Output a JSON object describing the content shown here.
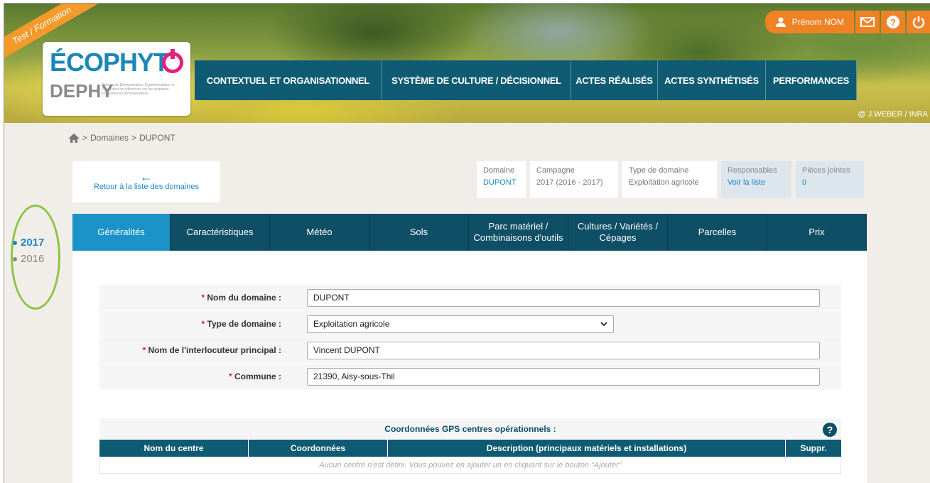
{
  "header": {
    "ribbon": "Test / Formation",
    "logo_top": "ÉCOPHYT",
    "logo_bottom": "DEPHY",
    "logo_sub": "Réseau de Démonstration, Expérimentation et Production de références sur les systèmes économes en phYtosanitaires",
    "credit": "@ J.WEBER / INRA",
    "user_name": "Prénom NOM",
    "nav": [
      "CONTEXTUEL ET ORGANISATIONNEL",
      "SYSTÈME DE CULTURE / DÉCISIONNEL",
      "ACTES RÉALISÉS",
      "ACTES SYNTHÉTISÉS",
      "PERFORMANCES"
    ]
  },
  "breadcrumb": {
    "sep1": ">",
    "domaines": "Domaines",
    "sep2": ">",
    "current": "DUPONT"
  },
  "years": [
    {
      "label": "2017",
      "active": true
    },
    {
      "label": "2016",
      "active": false
    }
  ],
  "back_link": "Retour à la liste des domaines",
  "info": {
    "domaine_label": "Domaine",
    "domaine_value": "DUPONT",
    "campagne_label": "Campagne",
    "campagne_value": "2017 (2016 - 2017)",
    "type_label": "Type de domaine",
    "type_value": "Exploitation agricole",
    "resp_label": "Responsables",
    "resp_value": "Voir la liste",
    "pj_label": "Pièces jointes",
    "pj_value": "0"
  },
  "tabs": [
    {
      "line1": "Généralités",
      "line2": ""
    },
    {
      "line1": "Caractéristiques",
      "line2": ""
    },
    {
      "line1": "Météo",
      "line2": ""
    },
    {
      "line1": "Sols",
      "line2": ""
    },
    {
      "line1": "Parc matériel /",
      "line2": "Combinaisons d'outils"
    },
    {
      "line1": "Cultures / Variétés /",
      "line2": "Cépages"
    },
    {
      "line1": "Parcelles",
      "line2": ""
    },
    {
      "line1": "Prix",
      "line2": ""
    }
  ],
  "form": {
    "nom_label": "Nom du domaine :",
    "nom_value": "DUPONT",
    "type_label": "Type de domaine :",
    "type_value": "Exploitation agricole",
    "interlocuteur_label": "Nom de l'interlocuteur principal :",
    "interlocuteur_value": "Vincent DUPONT",
    "commune_label": "Commune :",
    "commune_value": "21390, Aisy-sous-Thil",
    "required_mark": "*"
  },
  "gps": {
    "title": "Coordonnées GPS centres opérationnels :",
    "help": "?",
    "columns": [
      "Nom du centre",
      "Coordonnées",
      "Description (principaux matériels et installations)",
      "Suppr."
    ],
    "empty": "Aucun centre n'est défini. Vous pouvez en ajouter un en cliquant sur le bouton \"Ajouter\""
  }
}
